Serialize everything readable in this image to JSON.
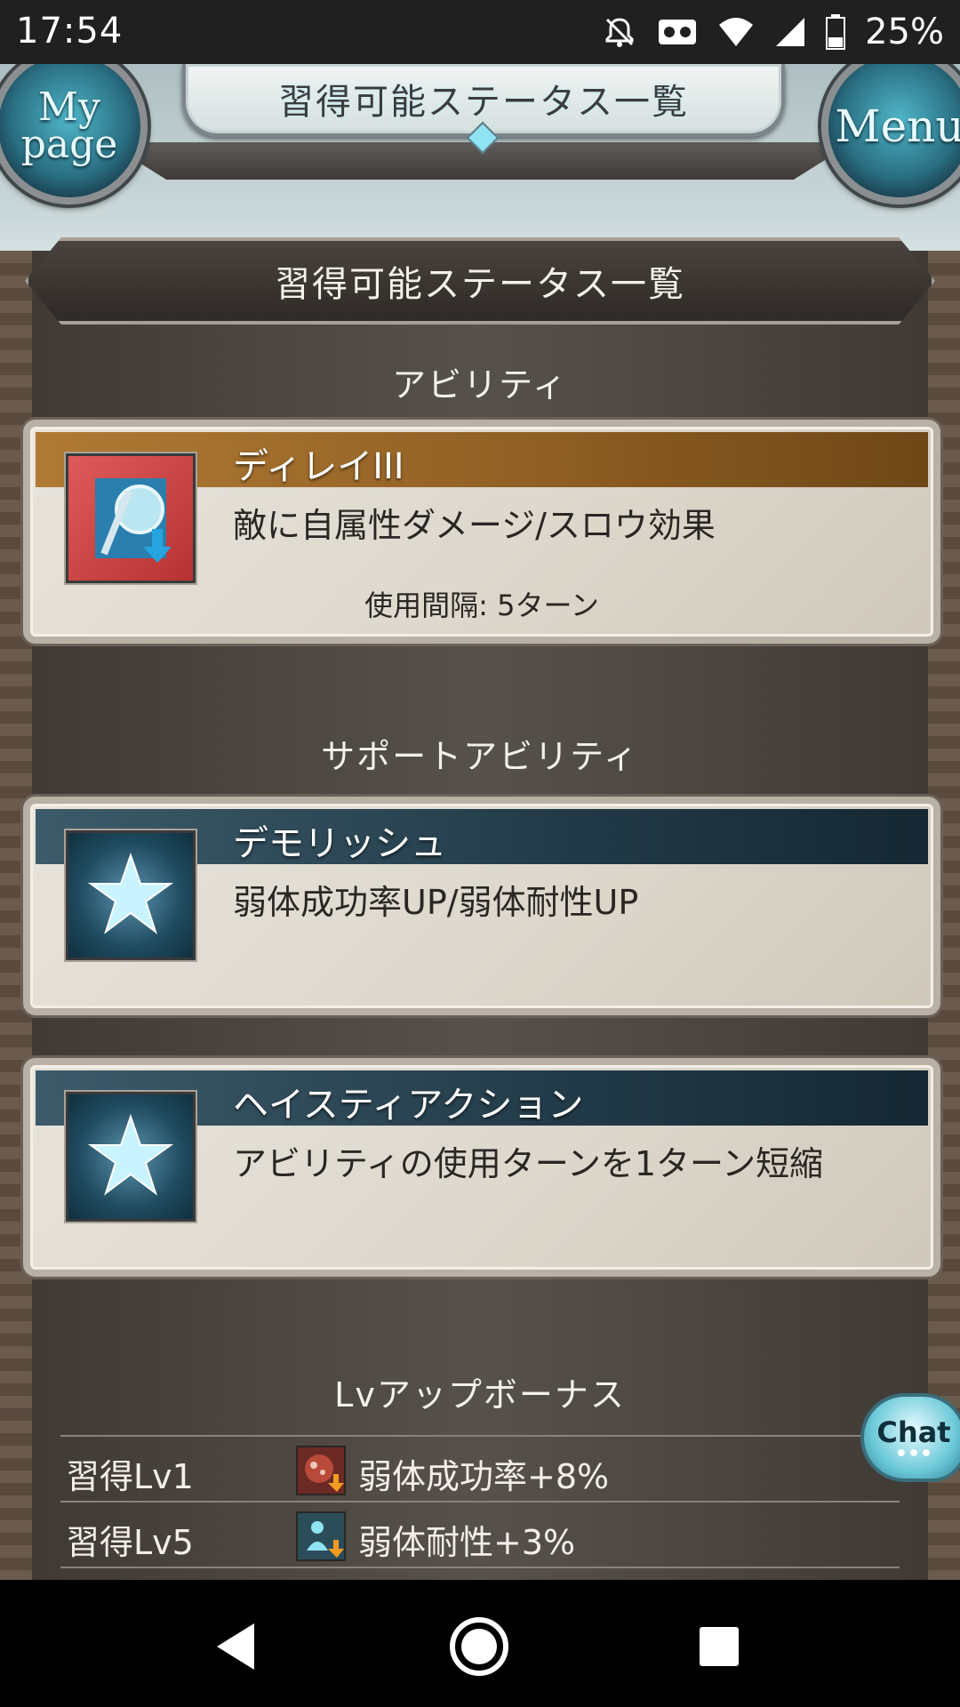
{
  "status_bar": {
    "time": "17:54",
    "battery": "25%"
  },
  "nav": {
    "mypage_label": "My page",
    "menu_label": "Menu",
    "title": "習得可能ステータス一覧"
  },
  "section": {
    "title": "習得可能ステータス一覧"
  },
  "ability": {
    "heading": "アビリティ",
    "items": [
      {
        "name": "ディレイIII",
        "description": "敵に自属性ダメージ/スロウ効果",
        "cooldown": "使用間隔: 5ターン",
        "icon": "delay-icon"
      }
    ]
  },
  "support": {
    "heading": "サポートアビリティ",
    "items": [
      {
        "name": "デモリッシュ",
        "description": "弱体成功率UP/弱体耐性UP",
        "icon": "star-icon"
      },
      {
        "name": "ヘイスティアクション",
        "description": "アビリティの使用ターンを1ターン短縮",
        "icon": "star-icon"
      }
    ]
  },
  "bonus": {
    "heading": "Lvアップボーナス",
    "rows": [
      {
        "level": "習得Lv1",
        "text": "弱体成功率+8%",
        "icon": "debuff-success-icon"
      },
      {
        "level": "習得Lv5",
        "text": "弱体耐性+3%",
        "icon": "debuff-resist-icon"
      }
    ]
  },
  "chat": {
    "label": "Chat"
  },
  "colors": {
    "orange_band": "#8d5d22",
    "blue_band": "#223a48",
    "accent": "#4fb6c8"
  }
}
